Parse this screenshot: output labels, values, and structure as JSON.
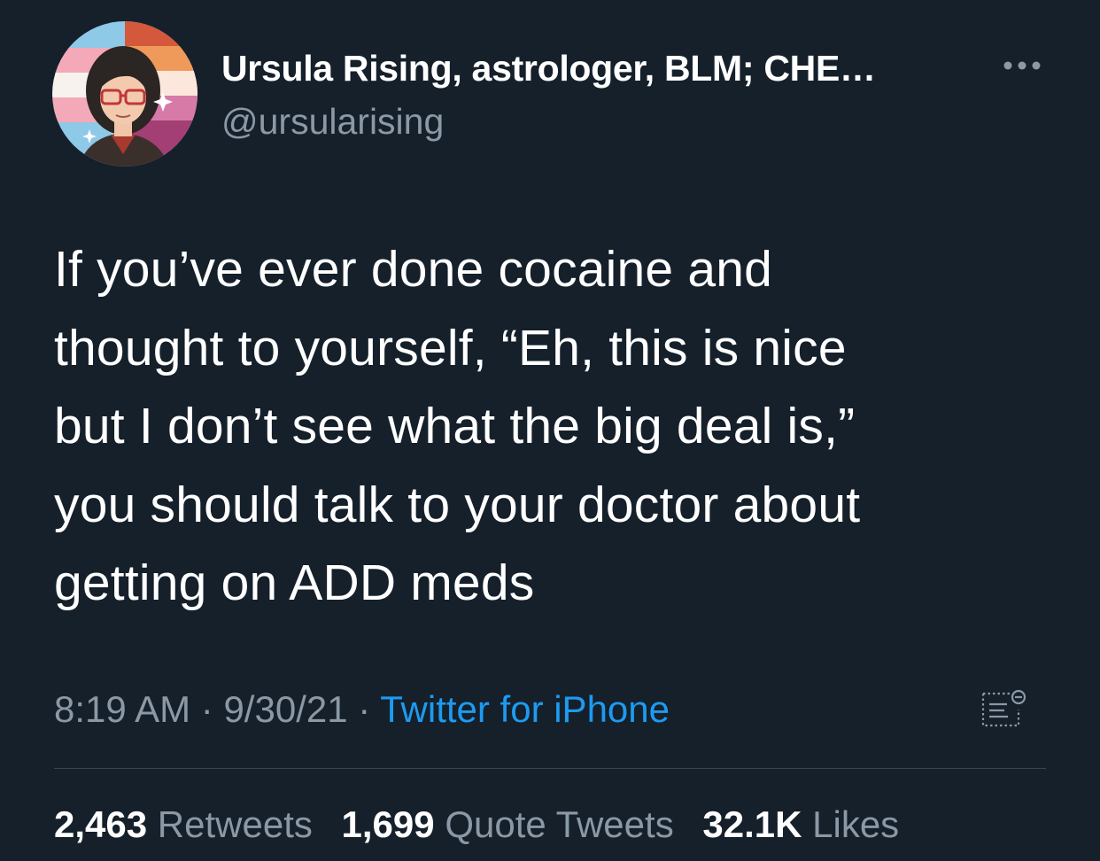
{
  "user": {
    "display_name": "Ursula Rising, astrologer, BLM; CHE…",
    "handle": "@ursularising",
    "avatar_icon": "illustrated-avatar"
  },
  "tweet": {
    "lines": [
      "If you’ve ever done cocaine and",
      "thought to yourself, “Eh, this is nice",
      "but I don’t see what the big deal is,”",
      "you should talk to your doctor about",
      "getting on ADD meds"
    ],
    "time": "8:19 AM",
    "date": "9/30/21",
    "separator": "·",
    "source": "Twitter for iPhone"
  },
  "stats": {
    "retweets": {
      "count": "2,463",
      "label": "Retweets"
    },
    "quotes": {
      "count": "1,699",
      "label": "Quote Tweets"
    },
    "likes": {
      "count": "32.1K",
      "label": "Likes"
    }
  },
  "icons": {
    "more": "more-horizontal-icon",
    "analytics": "tweet-analytics-icon"
  },
  "colors": {
    "background": "#15202b",
    "text": "#ffffff",
    "secondary": "#8b98a5",
    "link": "#1d9bf0",
    "divider": "#38444d"
  }
}
